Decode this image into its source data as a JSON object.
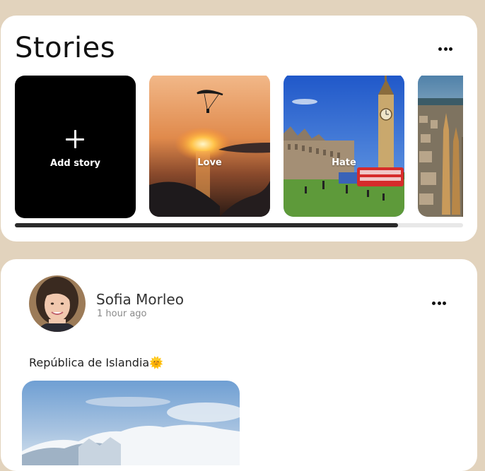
{
  "stories": {
    "title": "Stories",
    "items": [
      {
        "label": "Add story"
      },
      {
        "label": "Love"
      },
      {
        "label": "Hate"
      },
      {
        "label": ""
      }
    ],
    "scroll_progress_fraction": 0.855
  },
  "post": {
    "author": "Sofia Morleo",
    "time": "1 hour ago",
    "text": "República de Islandia🌞"
  },
  "icons": {
    "more": "more-horizontal-icon",
    "plus": "plus-icon"
  },
  "colors": {
    "page_background": "#e2d3bd",
    "card_background": "#ffffff",
    "add_story_background": "#000000",
    "scroll_thumb": "#2b2b2b",
    "scroll_track": "#e8e8e8"
  }
}
